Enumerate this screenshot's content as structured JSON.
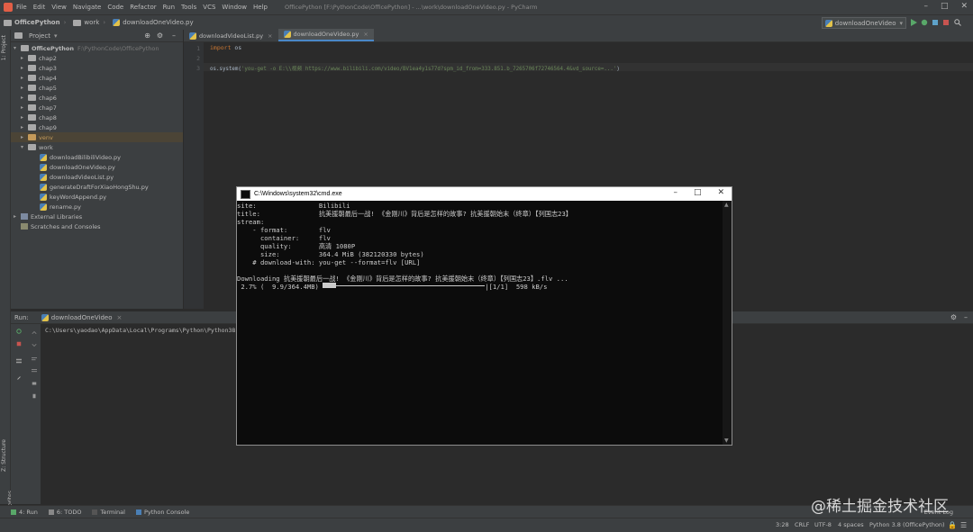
{
  "menubar": {
    "items": [
      "File",
      "Edit",
      "View",
      "Navigate",
      "Code",
      "Refactor",
      "Run",
      "Tools",
      "VCS",
      "Window",
      "Help"
    ],
    "window_title": "OfficePython [F:\\PythonCode\\OfficePython] - ...\\work\\downloadOneVideo.py - PyCharm"
  },
  "navbar": {
    "crumbs": [
      "OfficePython",
      "work",
      "downloadOneVideo.py"
    ],
    "run_config": "downloadOneVideo"
  },
  "left_strip": {
    "project": "1: Project",
    "structure": "Z: Structure",
    "favorites": "2: Favorites"
  },
  "project": {
    "header": "Project",
    "root_name": "OfficePython",
    "root_path": "F:\\PythonCode\\OfficePython",
    "folders": [
      "chap2",
      "chap3",
      "chap4",
      "chap5",
      "chap6",
      "chap7",
      "chap8",
      "chap9",
      "venv",
      "work"
    ],
    "files": [
      "downloadBilibiliVideo.py",
      "downloadOneVideo.py",
      "downloadVideoList.py",
      "generateDraftForXiaoHongShu.py",
      "keyWordAppend.py",
      "rename.py"
    ],
    "external": "External Libraries",
    "scratches": "Scratches and Consoles"
  },
  "editor": {
    "tabs": [
      "downloadVideoList.py",
      "downloadOneVideo.py"
    ],
    "line_numbers": [
      "1",
      "2",
      "3"
    ],
    "line1_kw": "import",
    "line1_rest": " os",
    "line3_fn": "os.system(",
    "line3_str": "'you-get -o E:\\\\视频 https://www.bilibili.com/video/BV1ea4y1s77d?spm_id_from=333.851.b_7265706f72746564.4&vd_source=...'",
    "line3_end": ")"
  },
  "run": {
    "label": "Run:",
    "tab": "downloadOneVideo",
    "output": "C:\\Users\\yaodao\\AppData\\Local\\Programs\\Python\\Python38"
  },
  "cmd": {
    "title": "C:\\Windows\\system32\\cmd.exe",
    "lines": [
      "site:                Bilibili",
      "title:               抗美援朝最后一战! 《金刚川》背后是怎样的故事? 抗美援朝始末（终章）【列国志23】",
      "stream:",
      "    - format:        flv",
      "      container:     flv",
      "      quality:       高清 1080P",
      "      size:          364.4 MiB (382120330 bytes)",
      "    # download-with: you-get --format=flv [URL]",
      "",
      "Downloading 抗美援朝最后一战! 《金刚川》背后是怎样的故事? 抗美援朝始末（终章）【列国志23】.flv ..."
    ],
    "progress_prefix": " 2.7% (  9.9/364.4MB) ",
    "progress_suffix": "|[1/1]  598 kB/s",
    "progress_fraction": 0.027
  },
  "bottom_tabs": [
    "4: Run",
    "6: TODO",
    "Terminal",
    "Python Console"
  ],
  "status": {
    "position": "3:28",
    "line_sep": "CRLF",
    "encoding": "UTF-8",
    "indent": "4 spaces",
    "interpreter": "Python 3.8 (OfficePython)",
    "event_log": "Event Log"
  },
  "watermark": "@稀土掘金技术社区"
}
